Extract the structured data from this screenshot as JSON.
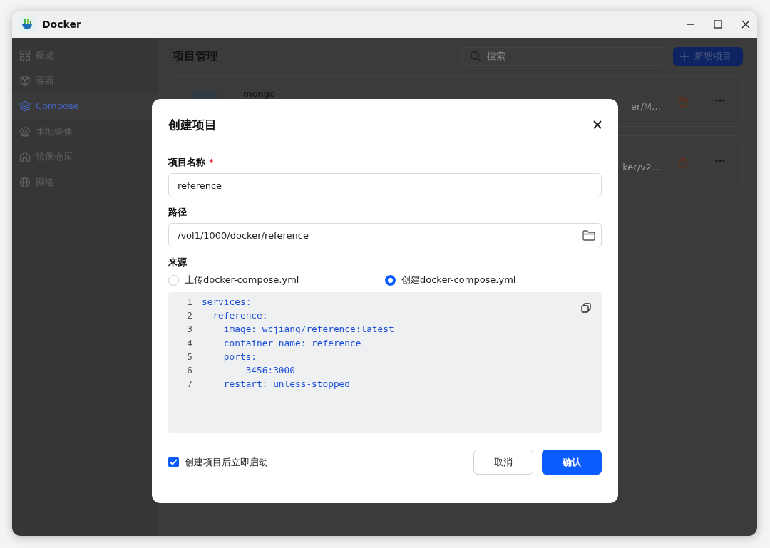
{
  "window": {
    "title": "Docker"
  },
  "sidebar": {
    "items": [
      {
        "label": "概览",
        "selected": false
      },
      {
        "label": "容器",
        "selected": false
      },
      {
        "label": "Compose",
        "selected": true
      },
      {
        "label": "本地镜像",
        "selected": false
      },
      {
        "label": "镜像仓库",
        "selected": false
      },
      {
        "label": "网络",
        "selected": false
      }
    ]
  },
  "main": {
    "title": "项目管理",
    "search": {
      "placeholder": "搜索"
    },
    "add_button": {
      "label": "新增项目"
    },
    "projects": [
      {
        "name": "mongo",
        "path": "er/M…"
      },
      {
        "path": "ker/v2…"
      }
    ]
  },
  "dialog": {
    "title": "创建项目",
    "fields": [
      {
        "kind": "text",
        "label": "项目名称",
        "required_mark": "*",
        "value": "reference"
      },
      {
        "kind": "folder",
        "label": "路径",
        "value": "/vol1/1000/docker/reference"
      }
    ],
    "source": {
      "label": "来源",
      "options": [
        {
          "label": "上传docker-compose.yml",
          "selected": false
        },
        {
          "label": "创建docker-compose.yml",
          "selected": true
        }
      ]
    },
    "editor": {
      "lines": [
        {
          "number": "1",
          "text": "services:"
        },
        {
          "number": "2",
          "text": "  reference:"
        },
        {
          "number": "3",
          "text": "    image: wcjiang/reference:latest"
        },
        {
          "number": "4",
          "text": "    container_name: reference"
        },
        {
          "number": "5",
          "text": "    ports:"
        },
        {
          "number": "6",
          "text": "      - 3456:3000"
        },
        {
          "number": "7",
          "text": "    restart: unless-stopped"
        }
      ]
    },
    "start_after": {
      "label": "创建项目后立即启动",
      "checked": true
    },
    "buttons": [
      {
        "kind": "secondary",
        "label": "取消"
      },
      {
        "kind": "primary",
        "label": "确认"
      }
    ]
  }
}
